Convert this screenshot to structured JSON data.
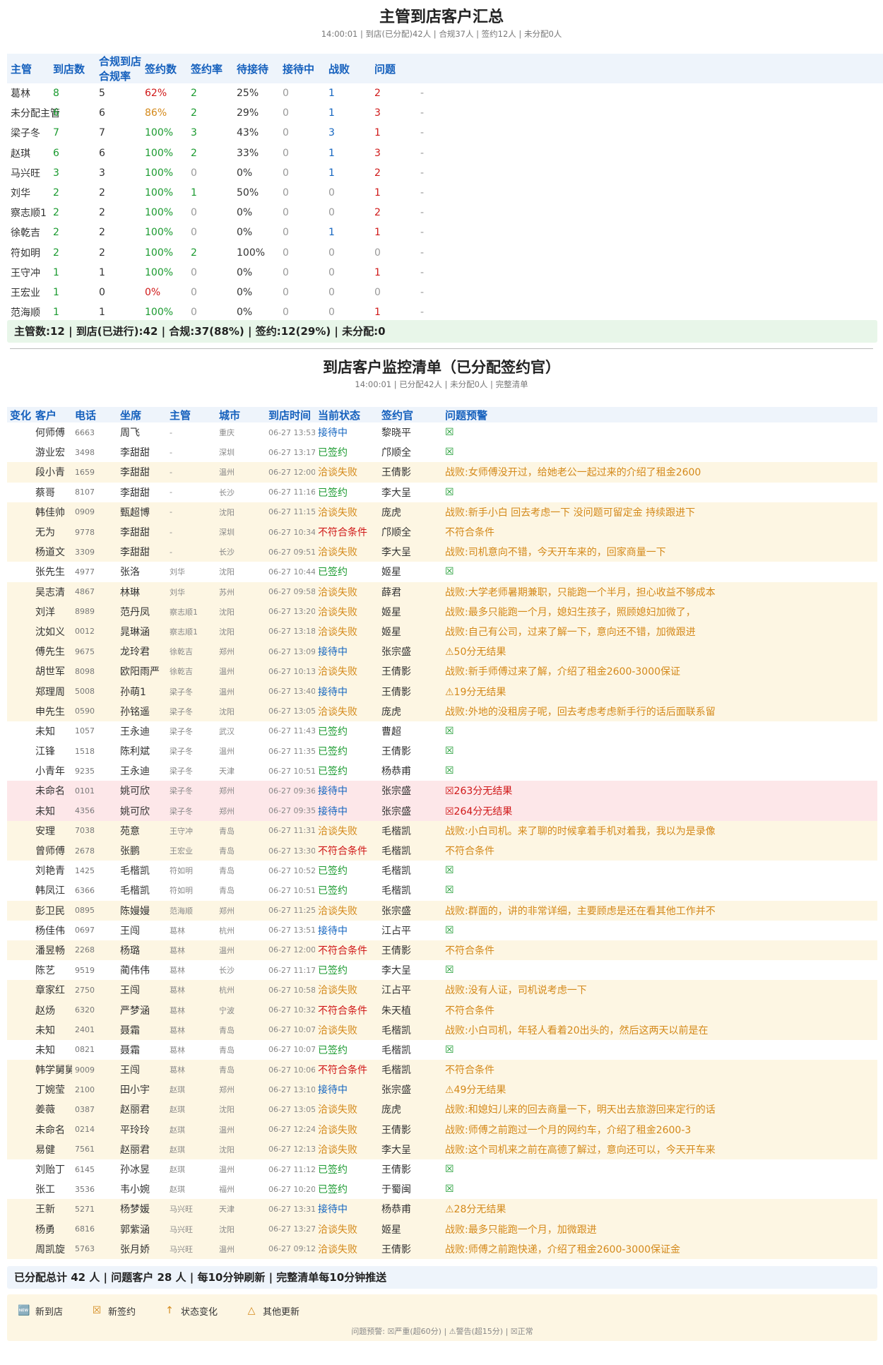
{
  "section1": {
    "title": "主管到店客户汇总",
    "subtitle": "14:00:01 | 到店(已分配)42人 | 合规37人 | 签约12人 | 未分配0人",
    "headers": [
      "主管",
      "到店数",
      "合规到店合规率",
      "签约数",
      "签约率",
      "待接待",
      "接待中",
      "战败",
      "问题"
    ],
    "rows": [
      {
        "name": "葛林",
        "arrive": "8",
        "comply": "5",
        "rate": "62%",
        "rate_color": "red",
        "sign": "2",
        "sign_rate": "25%",
        "wait": "0",
        "serving": "1",
        "fail": "2",
        "issue": "-"
      },
      {
        "name": "未分配主管",
        "arrive": "6",
        "comply": "6",
        "rate": "86%",
        "rate_color": "orange",
        "sign": "2",
        "sign_rate": "29%",
        "wait": "0",
        "serving": "1",
        "fail": "3",
        "issue": "-"
      },
      {
        "name": "梁子冬",
        "arrive": "7",
        "comply": "7",
        "rate": "100%",
        "rate_color": "green",
        "sign": "3",
        "sign_rate": "43%",
        "wait": "0",
        "serving": "3",
        "fail": "1",
        "issue": "-"
      },
      {
        "name": "赵琪",
        "arrive": "6",
        "comply": "6",
        "rate": "100%",
        "rate_color": "green",
        "sign": "2",
        "sign_rate": "33%",
        "wait": "0",
        "serving": "1",
        "fail": "3",
        "issue": "-"
      },
      {
        "name": "马兴旺",
        "arrive": "3",
        "comply": "3",
        "rate": "100%",
        "rate_color": "green",
        "sign": "0",
        "sign_rate": "0%",
        "wait": "0",
        "serving": "1",
        "fail": "2",
        "issue": "-"
      },
      {
        "name": "刘华",
        "arrive": "2",
        "comply": "2",
        "rate": "100%",
        "rate_color": "green",
        "sign": "1",
        "sign_rate": "50%",
        "wait": "0",
        "serving": "0",
        "fail": "1",
        "issue": "-"
      },
      {
        "name": "察志顺1",
        "arrive": "2",
        "comply": "2",
        "rate": "100%",
        "rate_color": "green",
        "sign": "0",
        "sign_rate": "0%",
        "wait": "0",
        "serving": "0",
        "fail": "2",
        "issue": "-"
      },
      {
        "name": "徐乾吉",
        "arrive": "2",
        "comply": "2",
        "rate": "100%",
        "rate_color": "green",
        "sign": "0",
        "sign_rate": "0%",
        "wait": "0",
        "serving": "1",
        "fail": "1",
        "issue": "-"
      },
      {
        "name": "符如明",
        "arrive": "2",
        "comply": "2",
        "rate": "100%",
        "rate_color": "green",
        "sign": "2",
        "sign_rate": "100%",
        "wait": "0",
        "serving": "0",
        "fail": "0",
        "issue": "-"
      },
      {
        "name": "王守冲",
        "arrive": "1",
        "comply": "1",
        "rate": "100%",
        "rate_color": "green",
        "sign": "0",
        "sign_rate": "0%",
        "wait": "0",
        "serving": "0",
        "fail": "1",
        "issue": "-"
      },
      {
        "name": "王宏业",
        "arrive": "1",
        "comply": "0",
        "rate": "0%",
        "rate_color": "red",
        "sign": "0",
        "sign_rate": "0%",
        "wait": "0",
        "serving": "0",
        "fail": "0",
        "issue": "-"
      },
      {
        "name": "范海顺",
        "arrive": "1",
        "comply": "1",
        "rate": "100%",
        "rate_color": "green",
        "sign": "0",
        "sign_rate": "0%",
        "wait": "0",
        "serving": "0",
        "fail": "1",
        "issue": "-"
      }
    ],
    "summary": "主管数:12 | 到店(已进行):42 | 合规:37(88%) | 签约:12(29%) | 未分配:0"
  },
  "section2": {
    "title": "到店客户监控清单（已分配签约官）",
    "subtitle": "14:00:01 | 已分配42人 | 未分配0人 | 完整清单",
    "headers": [
      "变化",
      "客户",
      "电话",
      "坐席",
      "主管",
      "城市",
      "到店时间",
      "当前状态",
      "签约官",
      "问题预警"
    ],
    "rows": [
      {
        "cust": "何师傅",
        "phone": "6663",
        "seat": "周飞",
        "mgr": "-",
        "city": "重庆",
        "time": "06-27 13:53",
        "status": "接待中",
        "agent": "黎晓平",
        "issue": "☒",
        "kind": "normal"
      },
      {
        "cust": "游业宏",
        "phone": "3498",
        "seat": "李甜甜",
        "mgr": "-",
        "city": "深圳",
        "time": "06-27 13:17",
        "status": "已签约",
        "agent": "邝顺全",
        "issue": "☒",
        "kind": "normal"
      },
      {
        "cust": "段小青",
        "phone": "1659",
        "seat": "李甜甜",
        "mgr": "-",
        "city": "温州",
        "time": "06-27 12:00",
        "status": "洽谈失败",
        "agent": "王倩影",
        "issue": "战败:女师傅没开过，给她老公一起过来的介绍了租金2600",
        "kind": "fail"
      },
      {
        "cust": "蔡哥",
        "phone": "8107",
        "seat": "李甜甜",
        "mgr": "-",
        "city": "长沙",
        "time": "06-27 11:16",
        "status": "已签约",
        "agent": "李大呈",
        "issue": "☒",
        "kind": "normal"
      },
      {
        "cust": "韩佳帅",
        "phone": "0909",
        "seat": "甄超博",
        "mgr": "-",
        "city": "沈阳",
        "time": "06-27 11:15",
        "status": "洽谈失败",
        "agent": "庞虎",
        "issue": "战败:新手小白 回去考虑一下 没问题可留定金 持续跟进下",
        "kind": "fail"
      },
      {
        "cust": "无为",
        "phone": "9778",
        "seat": "李甜甜",
        "mgr": "-",
        "city": "深圳",
        "time": "06-27 10:34",
        "status": "不符合条件",
        "agent": "邝顺全",
        "issue": "不符合条件",
        "kind": "nc"
      },
      {
        "cust": "杨道文",
        "phone": "3309",
        "seat": "李甜甜",
        "mgr": "-",
        "city": "长沙",
        "time": "06-27 09:51",
        "status": "洽谈失败",
        "agent": "李大呈",
        "issue": "战败:司机意向不错，今天开车来的，回家商量一下",
        "kind": "fail"
      },
      {
        "cust": "张先生",
        "phone": "4977",
        "seat": "张洛",
        "mgr": "刘华",
        "city": "沈阳",
        "time": "06-27 10:44",
        "status": "已签约",
        "agent": "姬星",
        "issue": "☒",
        "kind": "normal"
      },
      {
        "cust": "吴志清",
        "phone": "4867",
        "seat": "林琳",
        "mgr": "刘华",
        "city": "苏州",
        "time": "06-27 09:58",
        "status": "洽谈失败",
        "agent": "薛君",
        "issue": "战败:大学老师暑期兼职，只能跑一个半月，担心收益不够成本",
        "kind": "fail"
      },
      {
        "cust": "刘洋",
        "phone": "8989",
        "seat": "范丹凤",
        "mgr": "察志顺1",
        "city": "沈阳",
        "time": "06-27 13:20",
        "status": "洽谈失败",
        "agent": "姬星",
        "issue": "战败:最多只能跑一个月，媳妇生孩子，照顾媳妇加微了，",
        "kind": "fail"
      },
      {
        "cust": "沈如义",
        "phone": "0012",
        "seat": "晁琳涵",
        "mgr": "察志顺1",
        "city": "沈阳",
        "time": "06-27 13:18",
        "status": "洽谈失败",
        "agent": "姬星",
        "issue": "战败:自己有公司，过来了解一下，意向还不错，加微跟进",
        "kind": "fail"
      },
      {
        "cust": "傅先生",
        "phone": "9675",
        "seat": "龙玲君",
        "mgr": "徐乾吉",
        "city": "郑州",
        "time": "06-27 13:09",
        "status": "接待中",
        "agent": "张宗盛",
        "issue": "⚠50分无结果",
        "kind": "warn"
      },
      {
        "cust": "胡世军",
        "phone": "8098",
        "seat": "欧阳雨严",
        "mgr": "徐乾吉",
        "city": "温州",
        "time": "06-27 10:13",
        "status": "洽谈失败",
        "agent": "王倩影",
        "issue": "战败:新手师傅过来了解，介绍了租金2600-3000保证",
        "kind": "fail"
      },
      {
        "cust": "郑理周",
        "phone": "5008",
        "seat": "孙萌1",
        "mgr": "梁子冬",
        "city": "温州",
        "time": "06-27 13:40",
        "status": "接待中",
        "agent": "王倩影",
        "issue": "⚠19分无结果",
        "kind": "warn"
      },
      {
        "cust": "申先生",
        "phone": "0590",
        "seat": "孙铭遥",
        "mgr": "梁子冬",
        "city": "沈阳",
        "time": "06-27 13:05",
        "status": "洽谈失败",
        "agent": "庞虎",
        "issue": "战败:外地的没租房子呢，回去考虑考虑新手行的话后面联系留",
        "kind": "fail"
      },
      {
        "cust": "未知",
        "phone": "1057",
        "seat": "王永迪",
        "mgr": "梁子冬",
        "city": "武汉",
        "time": "06-27 11:43",
        "status": "已签约",
        "agent": "曹超",
        "issue": "☒",
        "kind": "normal"
      },
      {
        "cust": "江锋",
        "phone": "1518",
        "seat": "陈利斌",
        "mgr": "梁子冬",
        "city": "温州",
        "time": "06-27 11:35",
        "status": "已签约",
        "agent": "王倩影",
        "issue": "☒",
        "kind": "normal"
      },
      {
        "cust": "小青年",
        "phone": "9235",
        "seat": "王永迪",
        "mgr": "梁子冬",
        "city": "天津",
        "time": "06-27 10:51",
        "status": "已签约",
        "agent": "杨恭甫",
        "issue": "☒",
        "kind": "normal"
      },
      {
        "cust": "未命名",
        "phone": "0101",
        "seat": "姚可欣",
        "mgr": "梁子冬",
        "city": "郑州",
        "time": "06-27 09:36",
        "status": "接待中",
        "agent": "张宗盛",
        "issue": "☒263分无结果",
        "kind": "alert"
      },
      {
        "cust": "未知",
        "phone": "4356",
        "seat": "姚可欣",
        "mgr": "梁子冬",
        "city": "郑州",
        "time": "06-27 09:35",
        "status": "接待中",
        "agent": "张宗盛",
        "issue": "☒264分无结果",
        "kind": "alert"
      },
      {
        "cust": "安理",
        "phone": "7038",
        "seat": "苑意",
        "mgr": "王守冲",
        "city": "青岛",
        "time": "06-27 11:31",
        "status": "洽谈失败",
        "agent": "毛楷凯",
        "issue": "战败:小白司机。来了聊的时候拿着手机对着我，我以为是录像",
        "kind": "fail"
      },
      {
        "cust": "曾师傅",
        "phone": "2678",
        "seat": "张鹏",
        "mgr": "王宏业",
        "city": "青岛",
        "time": "06-27 13:30",
        "status": "不符合条件",
        "agent": "毛楷凯",
        "issue": "不符合条件",
        "kind": "nc"
      },
      {
        "cust": "刘艳青",
        "phone": "1425",
        "seat": "毛楷凯",
        "mgr": "符如明",
        "city": "青岛",
        "time": "06-27 10:52",
        "status": "已签约",
        "agent": "毛楷凯",
        "issue": "☒",
        "kind": "normal"
      },
      {
        "cust": "韩凤江",
        "phone": "6366",
        "seat": "毛楷凯",
        "mgr": "符如明",
        "city": "青岛",
        "time": "06-27 10:51",
        "status": "已签约",
        "agent": "毛楷凯",
        "issue": "☒",
        "kind": "normal"
      },
      {
        "cust": "彭卫民",
        "phone": "0895",
        "seat": "陈嫚嫚",
        "mgr": "范海顺",
        "city": "郑州",
        "time": "06-27 11:25",
        "status": "洽谈失败",
        "agent": "张宗盛",
        "issue": "战败:群面的，讲的非常详细，主要顾虑是还在看其他工作并不",
        "kind": "fail"
      },
      {
        "cust": "杨佳伟",
        "phone": "0697",
        "seat": "王闯",
        "mgr": "葛林",
        "city": "杭州",
        "time": "06-27 13:51",
        "status": "接待中",
        "agent": "江占平",
        "issue": "☒",
        "kind": "normal"
      },
      {
        "cust": "潘昱畅",
        "phone": "2268",
        "seat": "杨璐",
        "mgr": "葛林",
        "city": "温州",
        "time": "06-27 12:00",
        "status": "不符合条件",
        "agent": "王倩影",
        "issue": "不符合条件",
        "kind": "nc"
      },
      {
        "cust": "陈艺",
        "phone": "9519",
        "seat": "蔺伟伟",
        "mgr": "葛林",
        "city": "长沙",
        "time": "06-27 11:17",
        "status": "已签约",
        "agent": "李大呈",
        "issue": "☒",
        "kind": "normal"
      },
      {
        "cust": "章家红",
        "phone": "2750",
        "seat": "王闯",
        "mgr": "葛林",
        "city": "杭州",
        "time": "06-27 10:58",
        "status": "洽谈失败",
        "agent": "江占平",
        "issue": "战败:没有人证，司机说考虑一下",
        "kind": "fail"
      },
      {
        "cust": "赵炀",
        "phone": "6320",
        "seat": "严梦涵",
        "mgr": "葛林",
        "city": "宁波",
        "time": "06-27 10:32",
        "status": "不符合条件",
        "agent": "朱天植",
        "issue": "不符合条件",
        "kind": "nc"
      },
      {
        "cust": "未知",
        "phone": "2401",
        "seat": "聂霜",
        "mgr": "葛林",
        "city": "青岛",
        "time": "06-27 10:07",
        "status": "洽谈失败",
        "agent": "毛楷凯",
        "issue": "战败:小白司机，年轻人看着20出头的，然后这两天以前是在",
        "kind": "fail"
      },
      {
        "cust": "未知",
        "phone": "0821",
        "seat": "聂霜",
        "mgr": "葛林",
        "city": "青岛",
        "time": "06-27 10:07",
        "status": "已签约",
        "agent": "毛楷凯",
        "issue": "☒",
        "kind": "normal"
      },
      {
        "cust": "韩学舅舅",
        "phone": "9009",
        "seat": "王闯",
        "mgr": "葛林",
        "city": "青岛",
        "time": "06-27 10:06",
        "status": "不符合条件",
        "agent": "毛楷凯",
        "issue": "不符合条件",
        "kind": "nc"
      },
      {
        "cust": "丁婉莹",
        "phone": "2100",
        "seat": "田小宇",
        "mgr": "赵琪",
        "city": "郑州",
        "time": "06-27 13:10",
        "status": "接待中",
        "agent": "张宗盛",
        "issue": "⚠49分无结果",
        "kind": "warn"
      },
      {
        "cust": "姜薇",
        "phone": "0387",
        "seat": "赵丽君",
        "mgr": "赵琪",
        "city": "沈阳",
        "time": "06-27 13:05",
        "status": "洽谈失败",
        "agent": "庞虎",
        "issue": "战败:和媳妇儿来的回去商量一下，明天出去旅游回来定行的话",
        "kind": "fail"
      },
      {
        "cust": "未命名",
        "phone": "0214",
        "seat": "平玲玲",
        "mgr": "赵琪",
        "city": "温州",
        "time": "06-27 12:24",
        "status": "洽谈失败",
        "agent": "王倩影",
        "issue": "战败:师傅之前跑过一个月的网约车，介绍了租金2600-3",
        "kind": "fail"
      },
      {
        "cust": "易健",
        "phone": "7561",
        "seat": "赵丽君",
        "mgr": "赵琪",
        "city": "沈阳",
        "time": "06-27 12:13",
        "status": "洽谈失败",
        "agent": "李大呈",
        "issue": "战败:这个司机来之前在高德了解过，意向还可以，今天开车来",
        "kind": "fail"
      },
      {
        "cust": "刘贻丁",
        "phone": "6145",
        "seat": "孙冰昱",
        "mgr": "赵琪",
        "city": "温州",
        "time": "06-27 11:12",
        "status": "已签约",
        "agent": "王倩影",
        "issue": "☒",
        "kind": "normal"
      },
      {
        "cust": "张工",
        "phone": "3536",
        "seat": "韦小婉",
        "mgr": "赵琪",
        "city": "福州",
        "time": "06-27 10:20",
        "status": "已签约",
        "agent": "于蜀闽",
        "issue": "☒",
        "kind": "normal"
      },
      {
        "cust": "王新",
        "phone": "5271",
        "seat": "杨梦媛",
        "mgr": "马兴旺",
        "city": "天津",
        "time": "06-27 13:31",
        "status": "接待中",
        "agent": "杨恭甫",
        "issue": "⚠28分无结果",
        "kind": "warn"
      },
      {
        "cust": "杨勇",
        "phone": "6816",
        "seat": "郭紫涵",
        "mgr": "马兴旺",
        "city": "沈阳",
        "time": "06-27 13:27",
        "status": "洽谈失败",
        "agent": "姬星",
        "issue": "战败:最多只能跑一个月，加微跟进",
        "kind": "fail"
      },
      {
        "cust": "周凯旋",
        "phone": "5763",
        "seat": "张月娇",
        "mgr": "马兴旺",
        "city": "温州",
        "time": "06-27 09:12",
        "status": "洽谈失败",
        "agent": "王倩影",
        "issue": "战败:师傅之前跑快递，介绍了租金2600-3000保证金",
        "kind": "fail"
      }
    ],
    "summary": "已分配总计 42 人 | 问题客户 28 人 | 每10分钟刷新 | 完整清单每10分钟推送"
  },
  "legend": {
    "items": [
      {
        "icon": "🆕",
        "icon_name": "new-badge-icon",
        "label": "新到店"
      },
      {
        "icon": "☒",
        "icon_name": "check-box-icon",
        "label": "新签约"
      },
      {
        "icon": "↑",
        "icon_name": "arrow-up-icon",
        "label": "状态变化"
      },
      {
        "icon": "△",
        "icon_name": "triangle-icon",
        "label": "其他更新"
      }
    ],
    "note": "问题预警: ☒严重(超60分) | ⚠警告(超15分) | ☒正常"
  },
  "colors": {
    "accent": "#1560bd",
    "green": "#1a9a2f",
    "blue": "#1566c0",
    "red": "#d01818",
    "orange": "#d4891a",
    "row_fail_bg": "#fdf6e3",
    "row_alert_bg": "#fde7e9",
    "summary1_bg": "#e8f6e9",
    "summary2_bg": "#eef4fb"
  }
}
